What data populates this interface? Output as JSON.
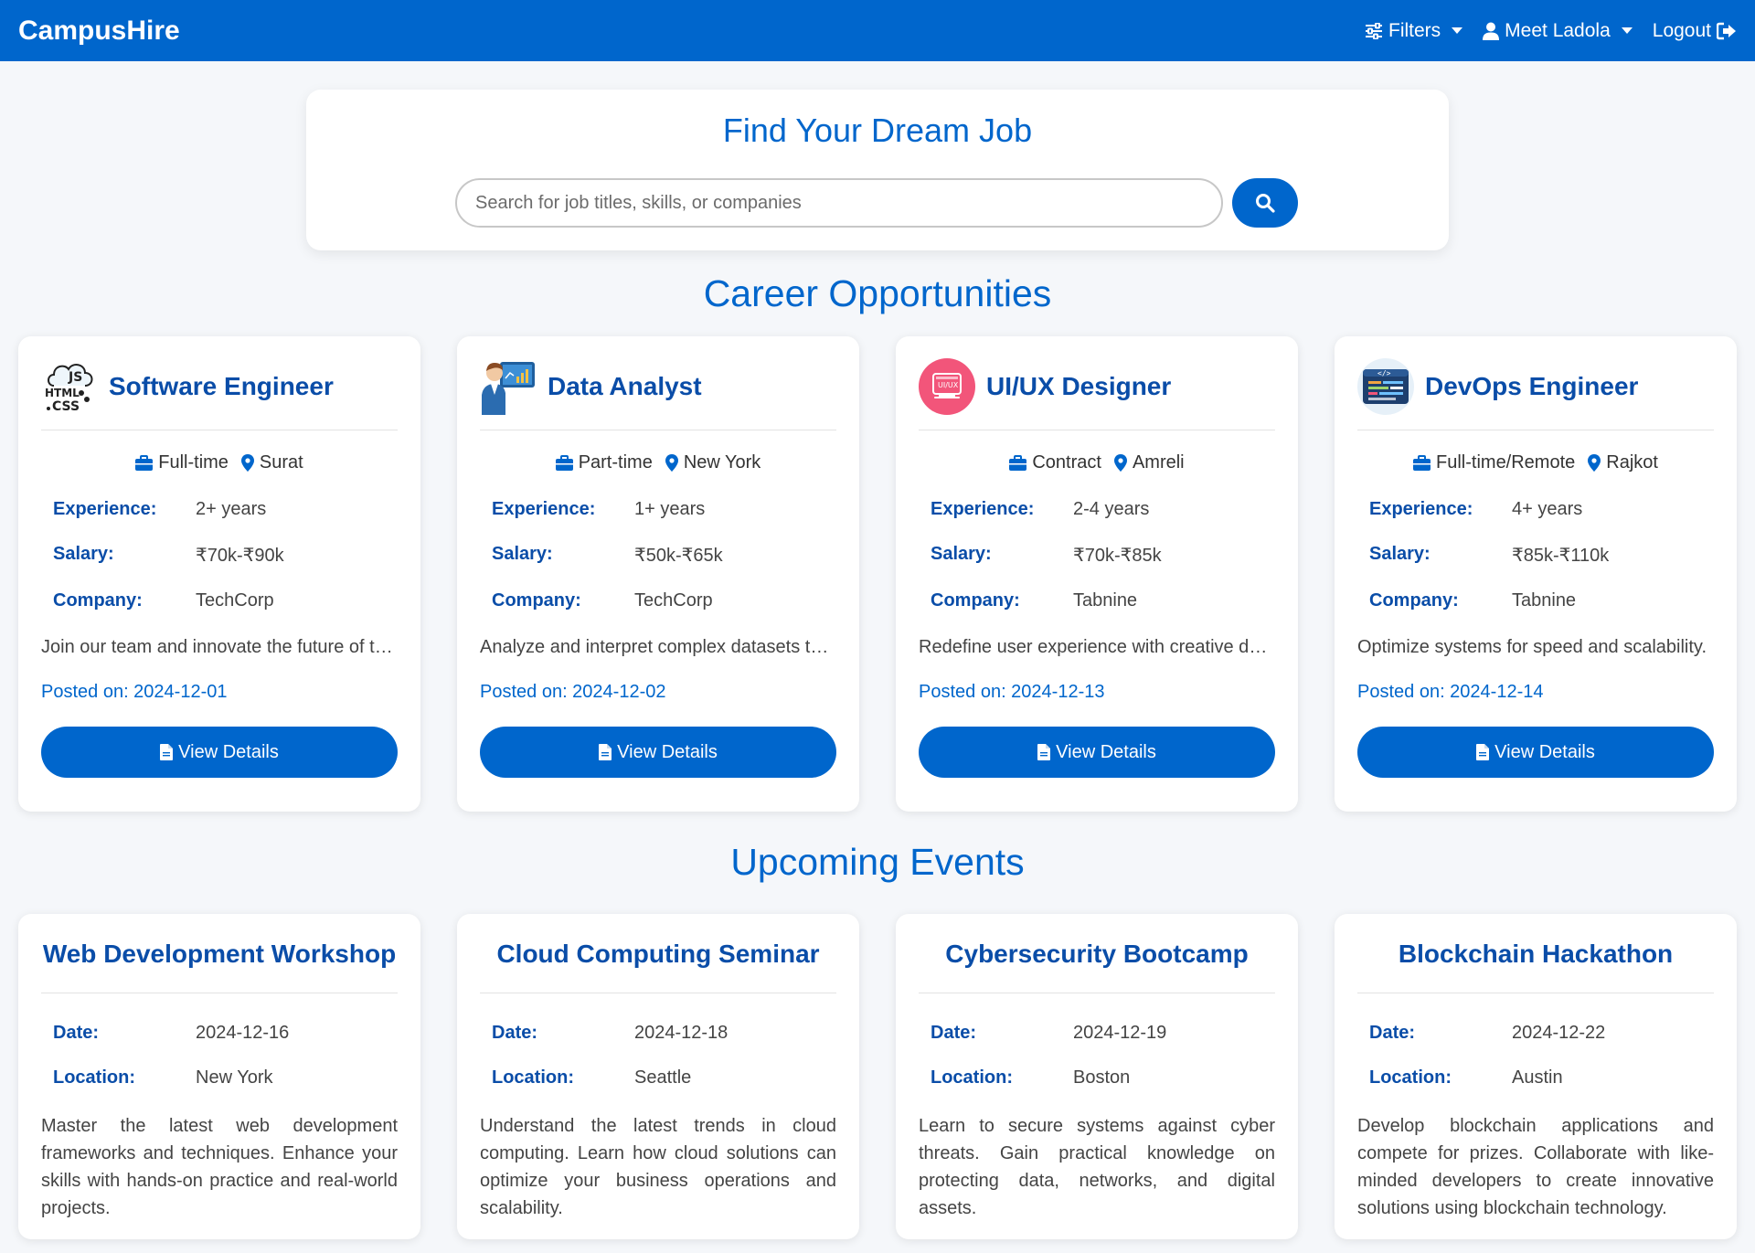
{
  "nav": {
    "brand": "CampusHire",
    "filters_label": "Filters",
    "user_label": "Meet Ladola",
    "logout_label": "Logout"
  },
  "search": {
    "title": "Find Your Dream Job",
    "placeholder": "Search for job titles, skills, or companies"
  },
  "careers": {
    "section_title": "Career Opportunities",
    "labels": {
      "experience": "Experience:",
      "salary": "Salary:",
      "company": "Company:",
      "posted_prefix": "Posted on: ",
      "view": "View Details"
    },
    "jobs": [
      {
        "title": "Software Engineer",
        "type": "Full-time",
        "location": "Surat",
        "experience": "2+ years",
        "salary": "₹70k-₹90k",
        "company": "TechCorp",
        "description": "Join our team and innovate the future of technology.",
        "posted": "Posted on: 2024-12-01",
        "icon": "html-css-js-icon"
      },
      {
        "title": "Data Analyst",
        "type": "Part-time",
        "location": "New York",
        "experience": "1+ years",
        "salary": "₹50k-₹65k",
        "company": "TechCorp",
        "description": "Analyze and interpret complex datasets to drive decisions.",
        "posted": "Posted on: 2024-12-02",
        "icon": "analyst-icon"
      },
      {
        "title": "UI/UX Designer",
        "type": "Contract",
        "location": "Amreli",
        "experience": "2-4 years",
        "salary": "₹70k-₹85k",
        "company": "Tabnine",
        "description": "Redefine user experience with creative designs.",
        "posted": "Posted on: 2024-12-13",
        "icon": "uiux-icon"
      },
      {
        "title": "DevOps Engineer",
        "type": "Full-time/Remote",
        "location": "Rajkot",
        "experience": "4+ years",
        "salary": "₹85k-₹110k",
        "company": "Tabnine",
        "description": "Optimize systems for speed and scalability.",
        "posted": "Posted on: 2024-12-14",
        "icon": "code-window-icon"
      }
    ]
  },
  "events": {
    "section_title": "Upcoming Events",
    "labels": {
      "date": "Date:",
      "location": "Location:"
    },
    "items": [
      {
        "title": "Web Development Workshop",
        "date": "2024-12-16",
        "location": "New York",
        "description": "Master the latest web development frameworks and techniques. Enhance your skills with hands-on practice and real-world projects."
      },
      {
        "title": "Cloud Computing Seminar",
        "date": "2024-12-18",
        "location": "Seattle",
        "description": "Understand the latest trends in cloud computing. Learn how cloud solutions can optimize your business operations and scalability."
      },
      {
        "title": "Cybersecurity Bootcamp",
        "date": "2024-12-19",
        "location": "Boston",
        "description": "Learn to secure systems against cyber threats. Gain practical knowledge on protecting data, networks, and digital assets."
      },
      {
        "title": "Blockchain Hackathon",
        "date": "2024-12-22",
        "location": "Austin",
        "description": "Develop blockchain applications and compete for prizes. Collaborate with like-minded developers to create innovative solutions using blockchain technology."
      }
    ]
  },
  "colors": {
    "primary": "#0066cc",
    "title_blue": "#0a4da8",
    "background": "#f5f7fa"
  }
}
